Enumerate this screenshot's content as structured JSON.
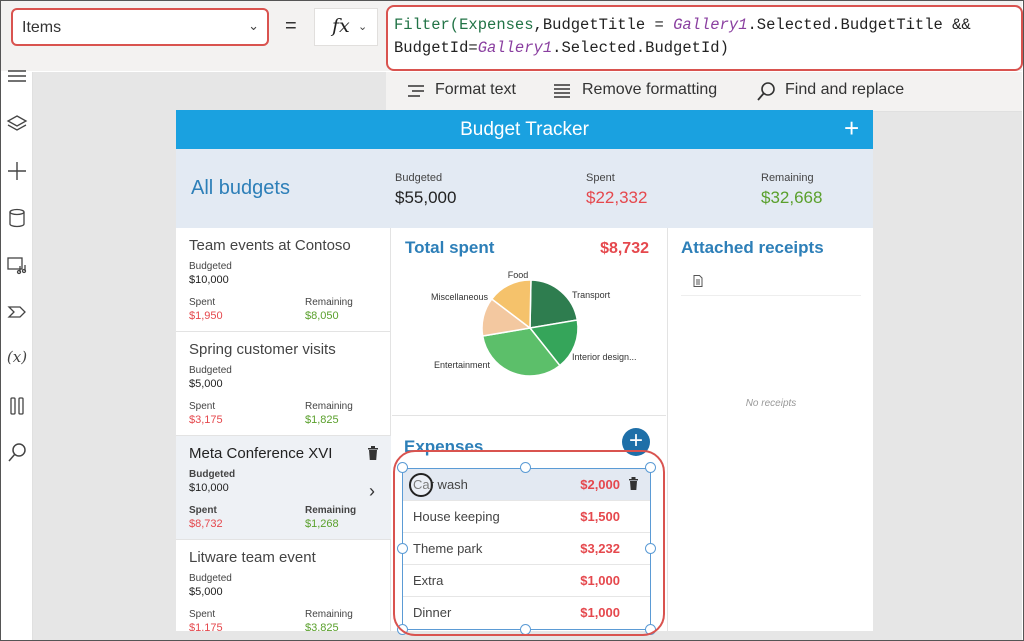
{
  "formula_bar": {
    "property": "Items",
    "equals": "=",
    "fx": "fx",
    "formula": {
      "fn": "Filter(",
      "source": "Expenses",
      "p1": ",BudgetTitle = ",
      "ctl1": "Gallery1",
      "p2": ".Selected.BudgetTitle &&",
      "p3": "BudgetId=",
      "ctl2": "Gallery1",
      "p4": ".Selected.BudgetId)"
    }
  },
  "format_strip": {
    "format_text": "Format text",
    "remove_formatting": "Remove formatting",
    "find_replace": "Find and replace"
  },
  "left_rail": [
    "menu-icon",
    "layers-icon",
    "plus-icon",
    "database-icon",
    "media-icon",
    "components-icon",
    "variables-icon",
    "tools-icon",
    "search-icon"
  ],
  "left_rail_var": "(x)",
  "app": {
    "title": "Budget Tracker",
    "add": "+",
    "summary": {
      "heading": "All budgets",
      "budgeted_label": "Budgeted",
      "budgeted_value": "$55,000",
      "spent_label": "Spent",
      "spent_value": "$22,332",
      "remaining_label": "Remaining",
      "remaining_value": "$32,668"
    },
    "budgets": [
      {
        "name": "Team events at Contoso",
        "budgeted_label": "Budgeted",
        "budgeted": "$10,000",
        "spent_label": "Spent",
        "spent": "$1,950",
        "remaining_label": "Remaining",
        "remaining": "$8,050"
      },
      {
        "name": "Spring customer visits",
        "budgeted_label": "Budgeted",
        "budgeted": "$5,000",
        "spent_label": "Spent",
        "spent": "$3,175",
        "remaining_label": "Remaining",
        "remaining": "$1,825"
      },
      {
        "name": "Meta Conference XVI",
        "budgeted_label": "Budgeted",
        "budgeted": "$10,000",
        "spent_label": "Spent",
        "spent": "$8,732",
        "remaining_label": "Remaining",
        "remaining": "$1,268"
      },
      {
        "name": "Litware team event",
        "budgeted_label": "Budgeted",
        "budgeted": "$5,000",
        "spent_label": "Spent",
        "spent": "$1,175",
        "remaining_label": "Remaining",
        "remaining": "$3,825"
      }
    ],
    "total_spent": {
      "title": "Total spent",
      "value": "$8,732"
    },
    "expenses": {
      "title": "Expenses",
      "add": "+",
      "rows": [
        {
          "name": "Car wash",
          "amount": "$2,000"
        },
        {
          "name": "House keeping",
          "amount": "$1,500"
        },
        {
          "name": "Theme park",
          "amount": "$3,232"
        },
        {
          "name": "Extra",
          "amount": "$1,000"
        },
        {
          "name": "Dinner",
          "amount": "$1,000"
        }
      ]
    },
    "receipts": {
      "title": "Attached receipts",
      "empty": "No receipts"
    }
  },
  "colors": {
    "header": "#1aa1e0",
    "accent_text": "#2d7fb8",
    "spent": "#e5484d",
    "remaining": "#5aa02c",
    "highlight": "#d9534f"
  },
  "chart_data": {
    "type": "pie",
    "title": "",
    "categories": [
      "Transport",
      "Interior design...",
      "Entertainment",
      "Miscellaneous",
      "Food"
    ],
    "values": [
      22,
      17,
      33,
      13,
      15
    ],
    "colors": [
      "#2e7d4f",
      "#35a55a",
      "#5cbf6a",
      "#f3c8a0",
      "#f5c26b"
    ]
  }
}
